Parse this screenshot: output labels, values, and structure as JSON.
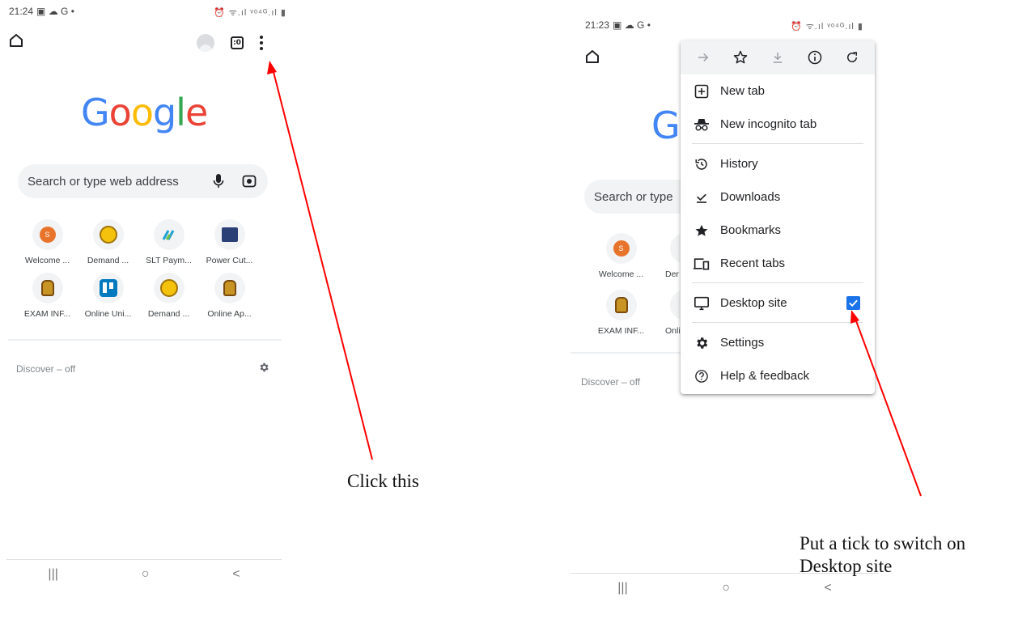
{
  "left_phone": {
    "status_time": "21:24",
    "status_icons_left": "▣ ☁ G •",
    "status_icons_right": "⏰ ᯤ.ıl ᵛᵒ⁴ᴳ.ıl ▮",
    "tab_count": ":0",
    "logo_letters": [
      "G",
      "o",
      "o",
      "g",
      "l",
      "e"
    ],
    "search_placeholder": "Search or type web address",
    "shortcuts": [
      {
        "label": "Welcome ...",
        "icon": "s-circle-icon"
      },
      {
        "label": "Demand ...",
        "icon": "emblem-icon"
      },
      {
        "label": "SLT Paym...",
        "icon": "slt-icon"
      },
      {
        "label": "Power Cut...",
        "icon": "tamil-guru-icon"
      },
      {
        "label": "EXAM INF...",
        "icon": "sri-lanka-crest-icon"
      },
      {
        "label": "Online Uni...",
        "icon": "trello-icon"
      },
      {
        "label": "Demand ...",
        "icon": "emblem-icon"
      },
      {
        "label": "Online Ap...",
        "icon": "sri-lanka-crest-icon"
      }
    ],
    "discover_label": "Discover – off",
    "nav": {
      "recents": "|||",
      "home": "○",
      "back": "<"
    }
  },
  "right_phone": {
    "status_time": "21:23",
    "status_icons_left": "▣ ☁ G •",
    "status_icons_right": "⏰ ᯤ.ıl ᵛᵒ⁴ᴳ.ıl ▮",
    "search_placeholder_partial": "Search or type",
    "logo_partial": "G",
    "shortcuts_partial": [
      {
        "label": "Welcome ...",
        "icon": "s-circle-icon"
      },
      {
        "label": "Der",
        "icon": "emblem-icon"
      },
      {
        "label": "EXAM INF...",
        "icon": "sri-lanka-crest-icon"
      },
      {
        "label": "Onli",
        "icon": "trello-icon"
      }
    ],
    "discover_label": "Discover – off",
    "nav": {
      "recents": "|||",
      "home": "○",
      "back": "<"
    },
    "menu": {
      "top_icons": [
        "forward-icon",
        "star-icon",
        "download-icon",
        "info-icon",
        "refresh-icon"
      ],
      "items_group1": [
        {
          "label": "New tab",
          "icon": "new-tab-icon"
        },
        {
          "label": "New incognito tab",
          "icon": "incognito-icon"
        }
      ],
      "items_group2": [
        {
          "label": "History",
          "icon": "history-icon"
        },
        {
          "label": "Downloads",
          "icon": "downloads-icon"
        },
        {
          "label": "Bookmarks",
          "icon": "bookmarks-icon"
        },
        {
          "label": "Recent tabs",
          "icon": "recent-tabs-icon"
        }
      ],
      "desktop_site": {
        "label": "Desktop site",
        "icon": "desktop-icon",
        "checked": true
      },
      "items_group3": [
        {
          "label": "Settings",
          "icon": "settings-icon"
        },
        {
          "label": "Help & feedback",
          "icon": "help-icon"
        }
      ]
    }
  },
  "annotations": {
    "click_this": "Click this",
    "tick_line1": "Put a tick to switch on",
    "tick_line2": "Desktop site"
  },
  "colors": {
    "arrow": "#ff0000",
    "checkbox": "#1a73e8",
    "orange_tile": "#e8742b"
  }
}
